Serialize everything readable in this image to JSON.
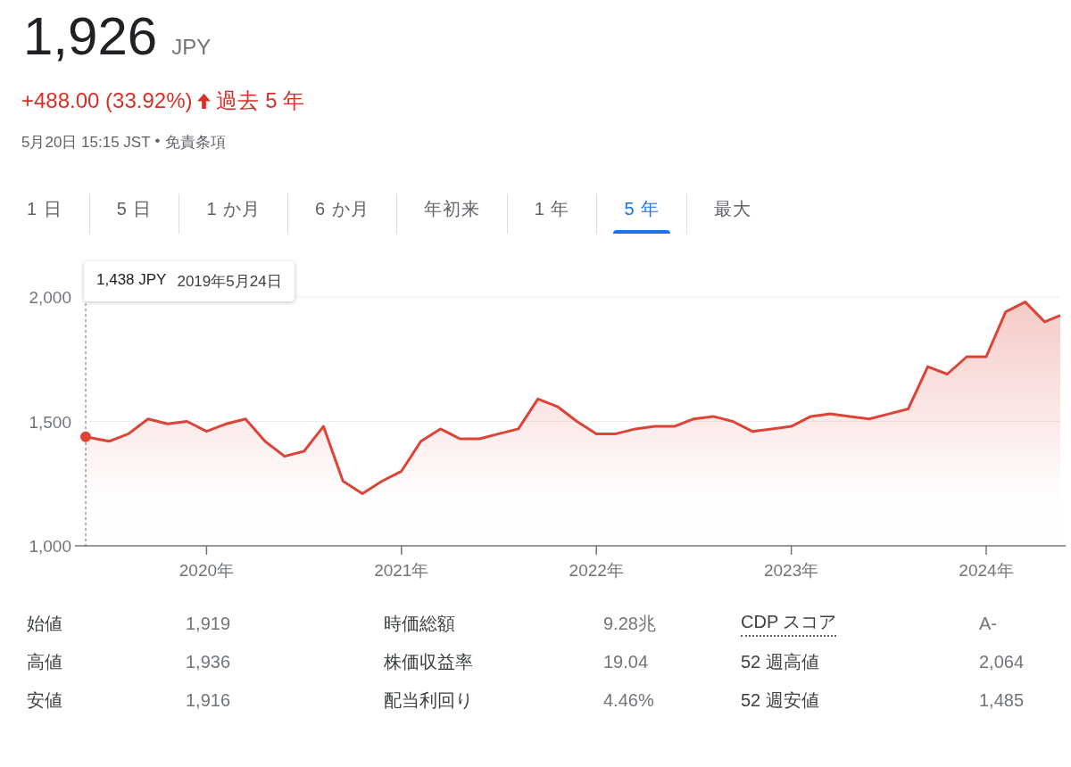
{
  "quote": {
    "price": "1,926",
    "currency": "JPY"
  },
  "change": {
    "text": "+488.00 (33.92%)",
    "period": "過去 5 年"
  },
  "meta": {
    "timestamp": "5月20日 15:15 JST",
    "separator": "•",
    "disclaimer": "免責条項"
  },
  "tabs": [
    {
      "label": "1 日",
      "selected": false
    },
    {
      "label": "5 日",
      "selected": false
    },
    {
      "label": "1 か月",
      "selected": false
    },
    {
      "label": "6 か月",
      "selected": false
    },
    {
      "label": "年初来",
      "selected": false
    },
    {
      "label": "1 年",
      "selected": false
    },
    {
      "label": "5 年",
      "selected": true
    },
    {
      "label": "最大",
      "selected": false
    }
  ],
  "chart": {
    "tooltip": {
      "price": "1,438 JPY",
      "date": "2019年5月24日"
    },
    "chart_data": {
      "type": "area",
      "ylim": [
        1000,
        2000
      ],
      "xlim": [
        2019.38,
        2024.38
      ],
      "yticks": [
        {
          "value": 1000,
          "label": "1,000"
        },
        {
          "value": 1500,
          "label": "1,500"
        },
        {
          "value": 2000,
          "label": "2,000"
        }
      ],
      "xticks": [
        {
          "value": 2020,
          "label": "2020年"
        },
        {
          "value": 2021,
          "label": "2021年"
        },
        {
          "value": 2022,
          "label": "2022年"
        },
        {
          "value": 2023,
          "label": "2023年"
        },
        {
          "value": 2024,
          "label": "2024年"
        }
      ],
      "x": [
        2019.38,
        2019.5,
        2019.6,
        2019.7,
        2019.8,
        2019.9,
        2020.0,
        2020.1,
        2020.2,
        2020.3,
        2020.4,
        2020.5,
        2020.6,
        2020.7,
        2020.8,
        2020.9,
        2021.0,
        2021.1,
        2021.2,
        2021.3,
        2021.4,
        2021.5,
        2021.6,
        2021.7,
        2021.8,
        2021.9,
        2022.0,
        2022.1,
        2022.2,
        2022.3,
        2022.4,
        2022.5,
        2022.6,
        2022.7,
        2022.8,
        2022.9,
        2023.0,
        2023.1,
        2023.2,
        2023.3,
        2023.4,
        2023.5,
        2023.6,
        2023.7,
        2023.8,
        2023.9,
        2024.0,
        2024.1,
        2024.2,
        2024.3,
        2024.38
      ],
      "series": [
        {
          "color": "#db4437",
          "values": [
            1438,
            1420,
            1450,
            1510,
            1490,
            1500,
            1460,
            1490,
            1510,
            1420,
            1360,
            1380,
            1480,
            1260,
            1210,
            1260,
            1300,
            1420,
            1470,
            1430,
            1430,
            1450,
            1470,
            1590,
            1560,
            1500,
            1450,
            1450,
            1470,
            1480,
            1480,
            1510,
            1520,
            1500,
            1460,
            1470,
            1480,
            1520,
            1530,
            1520,
            1510,
            1530,
            1550,
            1720,
            1690,
            1760,
            1760,
            1940,
            1980,
            1900,
            1926
          ]
        }
      ]
    }
  },
  "stats": [
    [
      {
        "label": "始値",
        "value": "1,919",
        "underlined": false
      },
      {
        "label": "高値",
        "value": "1,936",
        "underlined": false
      },
      {
        "label": "安値",
        "value": "1,916",
        "underlined": false
      }
    ],
    [
      {
        "label": "時価総額",
        "value": "9.28兆",
        "underlined": false
      },
      {
        "label": "株価収益率",
        "value": "19.04",
        "underlined": false
      },
      {
        "label": "配当利回り",
        "value": "4.46%",
        "underlined": false
      }
    ],
    [
      {
        "label": "CDP スコア",
        "value": "A-",
        "underlined": true
      },
      {
        "label": "52 週高値",
        "value": "2,064",
        "underlined": false
      },
      {
        "label": "52 週安値",
        "value": "1,485",
        "underlined": false
      }
    ]
  ]
}
